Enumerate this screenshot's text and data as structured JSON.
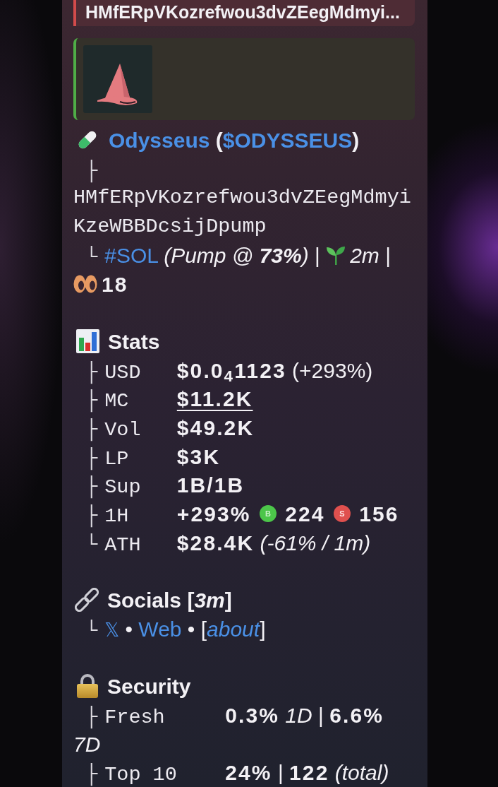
{
  "reply_quote": {
    "text": "HMfERpVKozrefwou3dvZEegMdmyi..."
  },
  "token": {
    "title": [
      {
        "kind": "link",
        "text": "Odysseus"
      },
      {
        "kind": "symbol",
        "open": "(",
        "text": "$ODYSSEUS",
        "close": ")"
      }
    ],
    "address": {
      "branch": "├",
      "text": "HMfERpVKozrefwou3dvZEegMdmyiKzeWBBDcsijDpump"
    },
    "info": {
      "branch": "└",
      "parts": [
        {
          "kind": "link",
          "text": "#SOL"
        },
        {
          "kind": "italic",
          "text": "(Pump @ **73%**)"
        },
        {
          "kind": "sep",
          "text": "|"
        },
        {
          "kind": "age",
          "text": "2m"
        },
        {
          "kind": "sep",
          "text": "|"
        },
        {
          "kind": "holders",
          "text": "18"
        }
      ]
    }
  },
  "sections": [
    {
      "kind": "stats",
      "heading": "Stats",
      "rows": [
        {
          "branch": "├",
          "label": "USD",
          "parts": [
            {
              "kind": "bold",
              "text": "$0.0$_{4}$1123"
            },
            {
              "kind": "note",
              "text": "(+293%)"
            }
          ]
        },
        {
          "branch": "├",
          "label": "MC",
          "parts": [
            {
              "kind": "link",
              "text": "$11.2K"
            }
          ]
        },
        {
          "branch": "├",
          "label": "Vol",
          "parts": [
            {
              "kind": "bold",
              "text": "$49.2K"
            }
          ]
        },
        {
          "branch": "├",
          "label": "LP",
          "parts": [
            {
              "kind": "bold",
              "text": "$3K"
            }
          ]
        },
        {
          "branch": "├",
          "label": "Sup",
          "parts": [
            {
              "kind": "bold",
              "text": "1B/1B"
            }
          ]
        },
        {
          "branch": "├",
          "label": "1H",
          "parts": [
            {
              "kind": "bold",
              "text": "+293%"
            },
            {
              "kind": "buy",
              "text": "B"
            },
            {
              "kind": "bold",
              "text": "224"
            },
            {
              "kind": "sell",
              "text": "S"
            },
            {
              "kind": "bold",
              "text": "156"
            }
          ]
        },
        {
          "branch": "└",
          "label": "ATH",
          "parts": [
            {
              "kind": "bold",
              "text": "$28.4K"
            },
            {
              "kind": "italic",
              "text": "(-61% / 1m)"
            }
          ]
        }
      ]
    },
    {
      "kind": "socials",
      "heading": "Socials [*3m*]",
      "rows": [
        {
          "branch": "└",
          "parts": [
            {
              "kind": "x",
              "text": "𝕏"
            },
            {
              "kind": "sep",
              "text": "•"
            },
            {
              "kind": "link",
              "text": "Web"
            },
            {
              "kind": "sep",
              "text": "•"
            },
            {
              "kind": "about",
              "open": "[",
              "text": "about",
              "close": "]"
            }
          ]
        }
      ]
    },
    {
      "kind": "security",
      "heading": "Security",
      "rows": [
        {
          "branch": "├",
          "label": "Fresh",
          "parts": [
            {
              "kind": "bold",
              "text": "0.3%"
            },
            {
              "kind": "italic",
              "text": "1D"
            },
            {
              "kind": "sep",
              "text": "|"
            },
            {
              "kind": "bold",
              "text": "6.6%"
            },
            {
              "kind": "italic",
              "text": "7D"
            }
          ]
        },
        {
          "branch": "├",
          "label": "Top 10",
          "parts": [
            {
              "kind": "bold",
              "text": "24%"
            },
            {
              "kind": "sep",
              "text": "|"
            },
            {
              "kind": "bold",
              "text": "122"
            },
            {
              "kind": "italic",
              "text": "(total)"
            }
          ]
        }
      ]
    }
  ]
}
